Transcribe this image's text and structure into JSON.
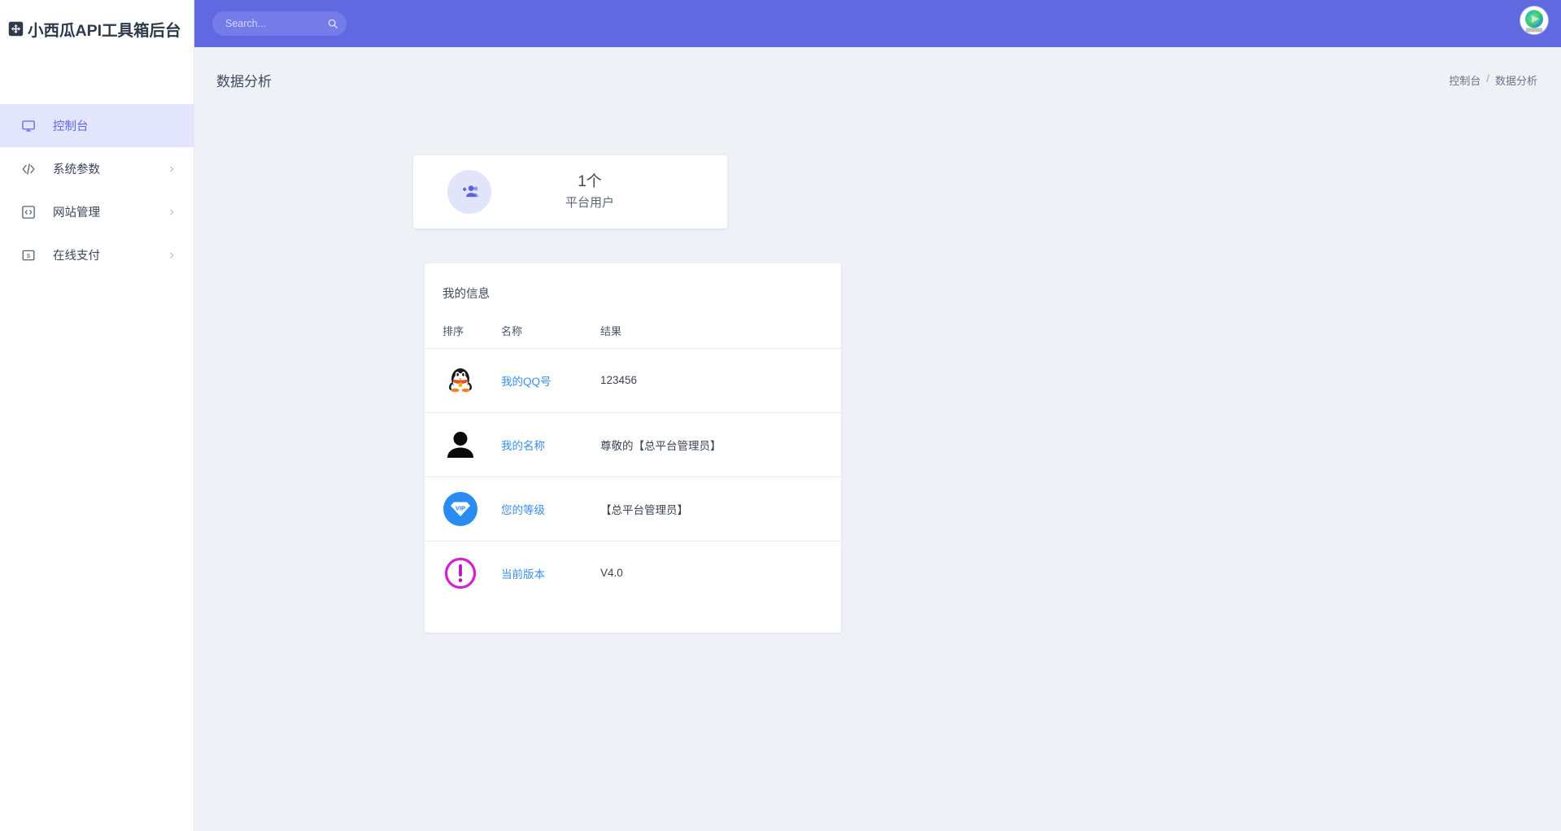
{
  "brand": {
    "logo_icon": "expand-square-icon",
    "title": "小西瓜API工具箱后台"
  },
  "sidebar": {
    "items": [
      {
        "label": "控制台",
        "icon": "monitor-icon",
        "active": true,
        "has_chevron": false
      },
      {
        "label": "系统参数",
        "icon": "code-brackets-icon",
        "active": false,
        "has_chevron": true
      },
      {
        "label": "网站管理",
        "icon": "code-box-icon",
        "active": false,
        "has_chevron": true
      },
      {
        "label": "在线支付",
        "icon": "money-icon",
        "active": false,
        "has_chevron": true
      }
    ]
  },
  "topbar": {
    "search": {
      "placeholder": "Search...",
      "value": "",
      "icon": "search-icon"
    },
    "avatar_icon": "play-logo-avatar"
  },
  "page": {
    "title": "数据分析",
    "breadcrumb": {
      "root": "控制台",
      "separator": "/",
      "current": "数据分析"
    }
  },
  "stat_card": {
    "icon": "person-add-icon",
    "value": "1个",
    "label": "平台用户",
    "icon_color": "#5a63d8",
    "circle_color": "#e2e4fa"
  },
  "info_card": {
    "title": "我的信息",
    "columns": [
      "排序",
      "名称",
      "结果"
    ],
    "rows": [
      {
        "icon": "qq-penguin-icon",
        "name": "我的QQ号",
        "result": "123456"
      },
      {
        "icon": "user-silhouette-icon",
        "name": "我的名称",
        "result": "尊敬的【总平台管理员】"
      },
      {
        "icon": "vip-diamond-icon",
        "name": "您的等级",
        "result": "【总平台管理员】"
      },
      {
        "icon": "exclamation-circle-icon",
        "name": "当前版本",
        "result": "V4.0"
      }
    ]
  },
  "colors": {
    "header_blue": "#6169e0",
    "sidebar_active_bg": "#e2e5fb",
    "sidebar_active_text": "#6168e2",
    "page_bg": "#eef1f5",
    "link_blue": "#3a8ee6",
    "vip_blue": "#2a8cf0",
    "version_magenta": "#d41fd4"
  }
}
